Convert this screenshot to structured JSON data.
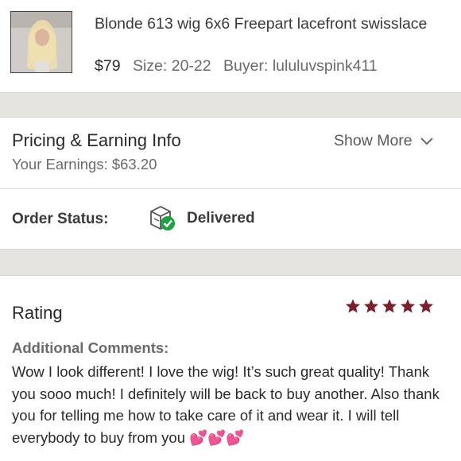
{
  "product": {
    "title": "Blonde 613 wig 6x6 Freepart lacefront swisslace",
    "price": "$79",
    "size": "Size: 20-22",
    "buyer": "Buyer: lululuvspink411"
  },
  "pricing": {
    "title": "Pricing & Earning Info",
    "earnings": "Your Earnings: $63.20",
    "show_more": "Show More"
  },
  "order_status": {
    "label": "Order Status:",
    "value": "Delivered"
  },
  "rating": {
    "title": "Rating",
    "stars": 5,
    "star_color": "#7b1f2b",
    "additional_label": "Additional Comments:",
    "comment": "Wow I look different! I love the wig! It’s such great quality! Thank you sooo much! I definitely will be back to buy another. Also thank you for telling me how to take care of it and wear it. I will tell everybody to buy from you 💕💕💕"
  },
  "colors": {
    "band": "#e6e4df",
    "check": "#21a045"
  }
}
